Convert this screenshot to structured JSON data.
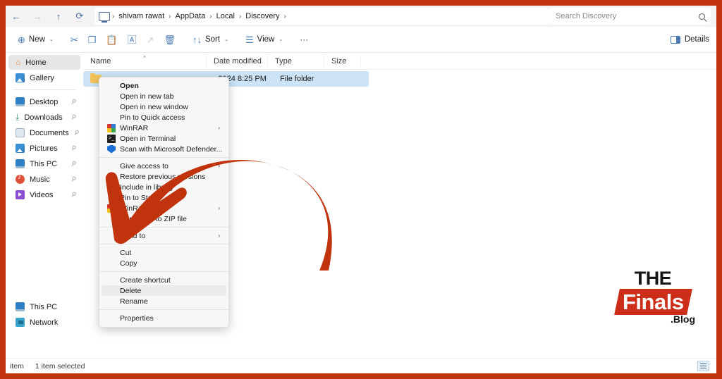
{
  "window": {
    "frame_color": "#c1330c",
    "accent_color": "#4a7bb5"
  },
  "addressbar": {
    "back_icon": "←",
    "forward_icon": "→",
    "up_icon": "↑",
    "refresh_icon": "⟳",
    "breadcrumbs": [
      {
        "label": "shivam rawat"
      },
      {
        "label": "AppData"
      },
      {
        "label": "Local"
      },
      {
        "label": "Discovery"
      }
    ],
    "separator": "›",
    "search_placeholder": "Search Discovery"
  },
  "toolbar": {
    "new_label": "New",
    "new_icon": "⊕",
    "cut_icon": "✂",
    "copy_icon": "❐",
    "paste_icon": "📋",
    "rename_icon": "🄰",
    "share_icon": "↗",
    "delete_icon": "🗑",
    "sort_label": "Sort",
    "sort_icon": "↑↓",
    "view_label": "View",
    "view_icon": "☰",
    "more_icon": "···",
    "chevron": "⌄",
    "details_label": "Details"
  },
  "sidebar": {
    "top_items": [
      {
        "label": "Home",
        "icon": "home-icon",
        "selected": true,
        "pinned": false
      },
      {
        "label": "Gallery",
        "icon": "gallery-icon",
        "selected": false,
        "pinned": false
      }
    ],
    "quick_access": [
      {
        "label": "Desktop",
        "icon": "desktop-icon",
        "pinned": true
      },
      {
        "label": "Downloads",
        "icon": "downloads-icon",
        "pinned": true
      },
      {
        "label": "Documents",
        "icon": "documents-icon",
        "pinned": true
      },
      {
        "label": "Pictures",
        "icon": "pictures-icon",
        "pinned": true
      },
      {
        "label": "This PC",
        "icon": "thispc-icon",
        "pinned": true
      },
      {
        "label": "Music",
        "icon": "music-icon",
        "pinned": true
      },
      {
        "label": "Videos",
        "icon": "videos-icon",
        "pinned": true
      }
    ],
    "bottom_items": [
      {
        "label": "This PC",
        "icon": "thispc-icon"
      },
      {
        "label": "Network",
        "icon": "network-icon"
      }
    ],
    "pin_glyph": "📌"
  },
  "filelist": {
    "columns": [
      {
        "label": "Name"
      },
      {
        "label": "Date modified"
      },
      {
        "label": "Type"
      },
      {
        "label": "Size"
      }
    ],
    "sort_caret": "^",
    "rows": [
      {
        "name": "",
        "date_modified": "2024 8:25 PM",
        "type": "File folder",
        "size": "",
        "selected": true
      }
    ]
  },
  "context_menu": {
    "items": [
      {
        "label": "Open",
        "icon": null,
        "bold": true,
        "submenu": false,
        "highlighted": false
      },
      {
        "label": "Open in new tab",
        "icon": null,
        "bold": false,
        "submenu": false,
        "highlighted": false
      },
      {
        "label": "Open in new window",
        "icon": null,
        "bold": false,
        "submenu": false,
        "highlighted": false
      },
      {
        "label": "Pin to Quick access",
        "icon": null,
        "bold": false,
        "submenu": false,
        "highlighted": false
      },
      {
        "label": "WinRAR",
        "icon": "winrar-icon",
        "bold": false,
        "submenu": true,
        "highlighted": false
      },
      {
        "label": "Open in Terminal",
        "icon": "terminal-icon",
        "bold": false,
        "submenu": false,
        "highlighted": false
      },
      {
        "label": "Scan with Microsoft Defender...",
        "icon": "defender-icon",
        "bold": false,
        "submenu": false,
        "highlighted": false
      },
      {
        "separator": true
      },
      {
        "label": "Give access to",
        "icon": null,
        "bold": false,
        "submenu": true,
        "highlighted": false
      },
      {
        "label": "Restore previous versions",
        "icon": null,
        "bold": false,
        "submenu": false,
        "highlighted": false
      },
      {
        "label": "Include in library",
        "icon": null,
        "bold": false,
        "submenu": false,
        "highlighted": false
      },
      {
        "label": "Pin to Start",
        "icon": null,
        "bold": false,
        "submenu": false,
        "highlighted": false
      },
      {
        "label": "WinRAR",
        "icon": "winrar-icon",
        "bold": false,
        "submenu": true,
        "highlighted": false
      },
      {
        "label": "Compress to ZIP file",
        "icon": null,
        "bold": false,
        "submenu": false,
        "highlighted": false
      },
      {
        "separator": true
      },
      {
        "label": "Send to",
        "icon": null,
        "bold": false,
        "submenu": true,
        "highlighted": false
      },
      {
        "separator": true
      },
      {
        "label": "Cut",
        "icon": null,
        "bold": false,
        "submenu": false,
        "highlighted": false
      },
      {
        "label": "Copy",
        "icon": null,
        "bold": false,
        "submenu": false,
        "highlighted": false
      },
      {
        "separator": true
      },
      {
        "label": "Create shortcut",
        "icon": null,
        "bold": false,
        "submenu": false,
        "highlighted": false
      },
      {
        "label": "Delete",
        "icon": null,
        "bold": false,
        "submenu": false,
        "highlighted": true
      },
      {
        "label": "Rename",
        "icon": null,
        "bold": false,
        "submenu": false,
        "highlighted": false
      },
      {
        "separator": true
      },
      {
        "label": "Properties",
        "icon": null,
        "bold": false,
        "submenu": false,
        "highlighted": false
      }
    ],
    "submenu_arrow": "›"
  },
  "annotation": {
    "arrow_color": "#c1330c",
    "arrow_description": "curved-red-arrow-pointing-down-left"
  },
  "statusbar": {
    "item_count": "item",
    "selection": "1 item selected"
  },
  "watermark": {
    "line1": "THE",
    "line2": "Finals",
    "line3": ".Blog",
    "band_color": "#cc2e1a"
  }
}
